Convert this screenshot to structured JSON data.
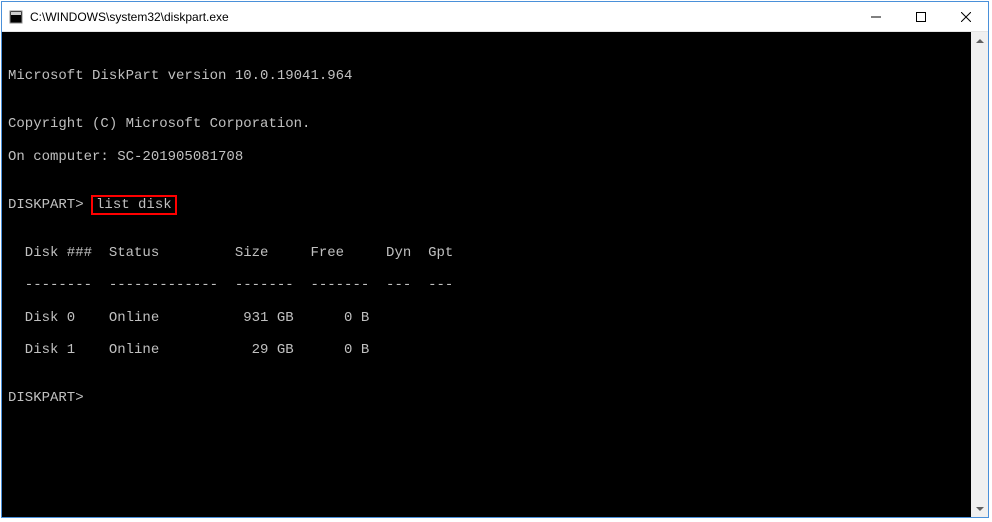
{
  "window": {
    "title": "C:\\WINDOWS\\system32\\diskpart.exe"
  },
  "terminal": {
    "blank": "",
    "line1": "Microsoft DiskPart version 10.0.19041.964",
    "line2": "Copyright (C) Microsoft Corporation.",
    "line3": "On computer: SC-201905081708",
    "prompt1_prefix": "DISKPART> ",
    "prompt1_command": "list disk",
    "table_header": "  Disk ###  Status         Size     Free     Dyn  Gpt",
    "table_divider": "  --------  -------------  -------  -------  ---  ---",
    "disk0": "  Disk 0    Online          931 GB      0 B",
    "disk1": "  Disk 1    Online           29 GB      0 B",
    "prompt2": "DISKPART>"
  },
  "chart_data": {
    "type": "table",
    "title": "list disk",
    "columns": [
      "Disk ###",
      "Status",
      "Size",
      "Free",
      "Dyn",
      "Gpt"
    ],
    "rows": [
      {
        "disk": "Disk 0",
        "status": "Online",
        "size": "931 GB",
        "free": "0 B",
        "dyn": "",
        "gpt": ""
      },
      {
        "disk": "Disk 1",
        "status": "Online",
        "size": "29 GB",
        "free": "0 B",
        "dyn": "",
        "gpt": ""
      }
    ]
  }
}
